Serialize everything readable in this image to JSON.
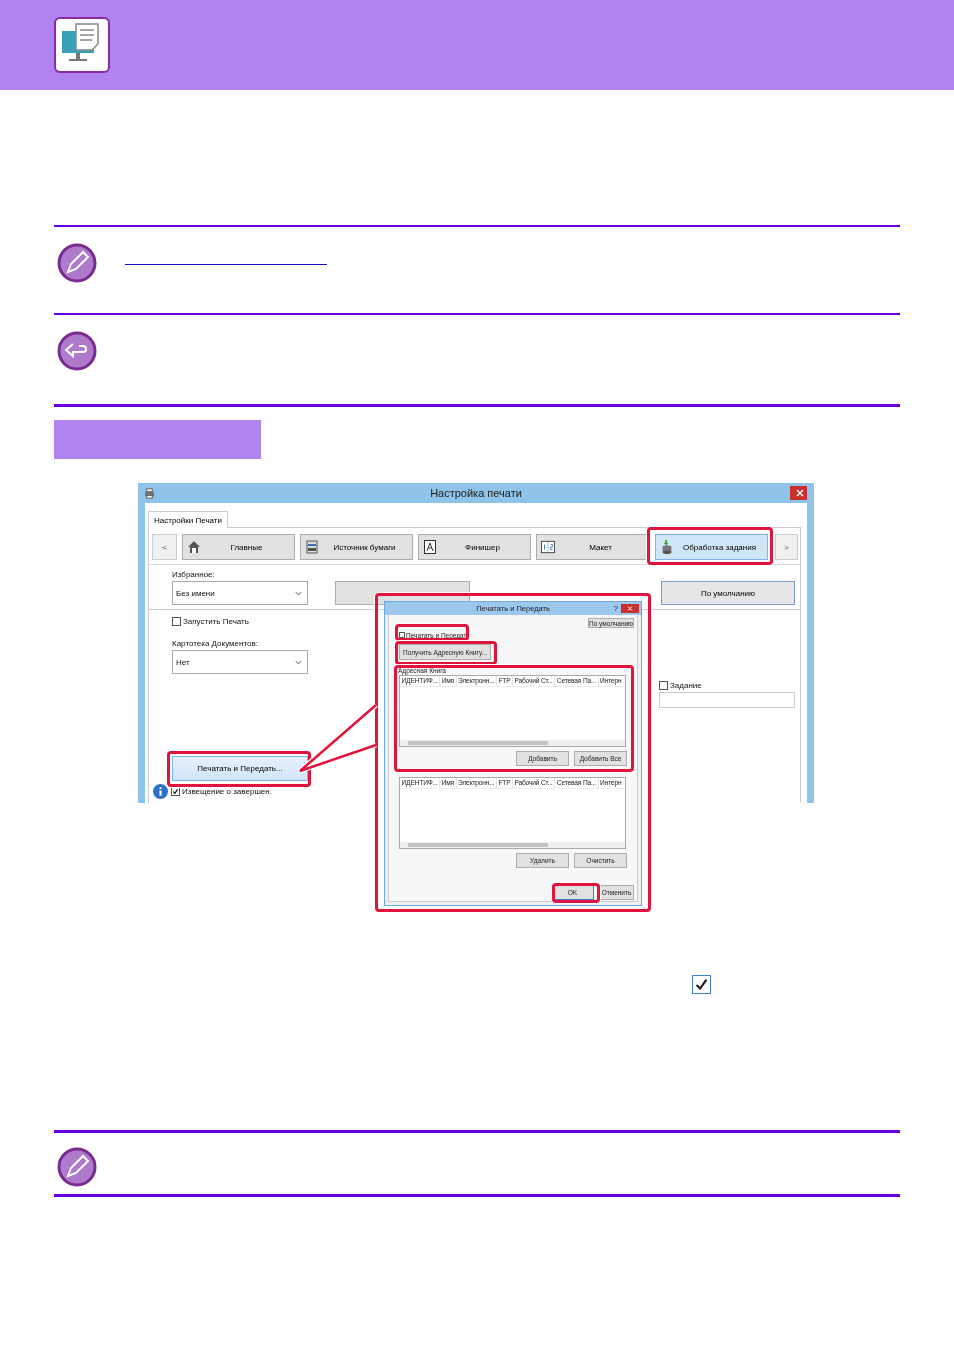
{
  "window": {
    "title": "Настройка печати"
  },
  "tabs": [
    {
      "label": "Настройки Печати",
      "selected": true
    }
  ],
  "nav": {
    "prev": "<",
    "next": ">"
  },
  "categories": [
    {
      "label": "Главные",
      "kind": "home",
      "selected": false
    },
    {
      "label": "Источник бумаги",
      "kind": "tray",
      "selected": false
    },
    {
      "label": "Финишер",
      "kind": "finisher",
      "selected": false
    },
    {
      "label": "Макет",
      "kind": "layout",
      "selected": false
    },
    {
      "label": "Обработка задания",
      "kind": "job",
      "selected": true
    }
  ],
  "favorites": {
    "label": "Избранное:",
    "value": "Без имени"
  },
  "default_button": "По умолчанию",
  "start_print": {
    "label": "Запустить Печать",
    "checked": false
  },
  "doc_filing": {
    "label": "Картотека Документов:",
    "value": "Нет"
  },
  "print_send_button": "Печатать и Передать...",
  "notify": {
    "label": "Извещение о завершен.",
    "checked": true
  },
  "job": {
    "label": "Задание",
    "checked": false
  },
  "dialog": {
    "title": "Печатать и Передать",
    "help": "?",
    "default_button": "По умолчанию",
    "print_send": {
      "label": "Печатать и Передат",
      "checked": false
    },
    "get_address_button": "Получить Адресную Книгу...",
    "address_book": {
      "title": "Адресная Книга",
      "columns": [
        "ИДЕНТИФ...",
        "Имя",
        "Электронн...",
        "FTP",
        "Рабочий Ст...",
        "Сетевая Па...",
        "Интерн"
      ]
    },
    "add_buttons": [
      "Добавить",
      "Добавить Все"
    ],
    "destinations": {
      "columns": [
        "ИДЕНТИФ...",
        "Имя",
        "Электронн...",
        "FTP",
        "Рабочий Ст...",
        "Сетевая Па...",
        "Интерн"
      ]
    },
    "list_buttons": [
      "Удалить",
      "Очистить"
    ],
    "buttons": [
      "OK",
      "Отменить"
    ]
  },
  "inline_checkbox": {
    "checked": true
  }
}
